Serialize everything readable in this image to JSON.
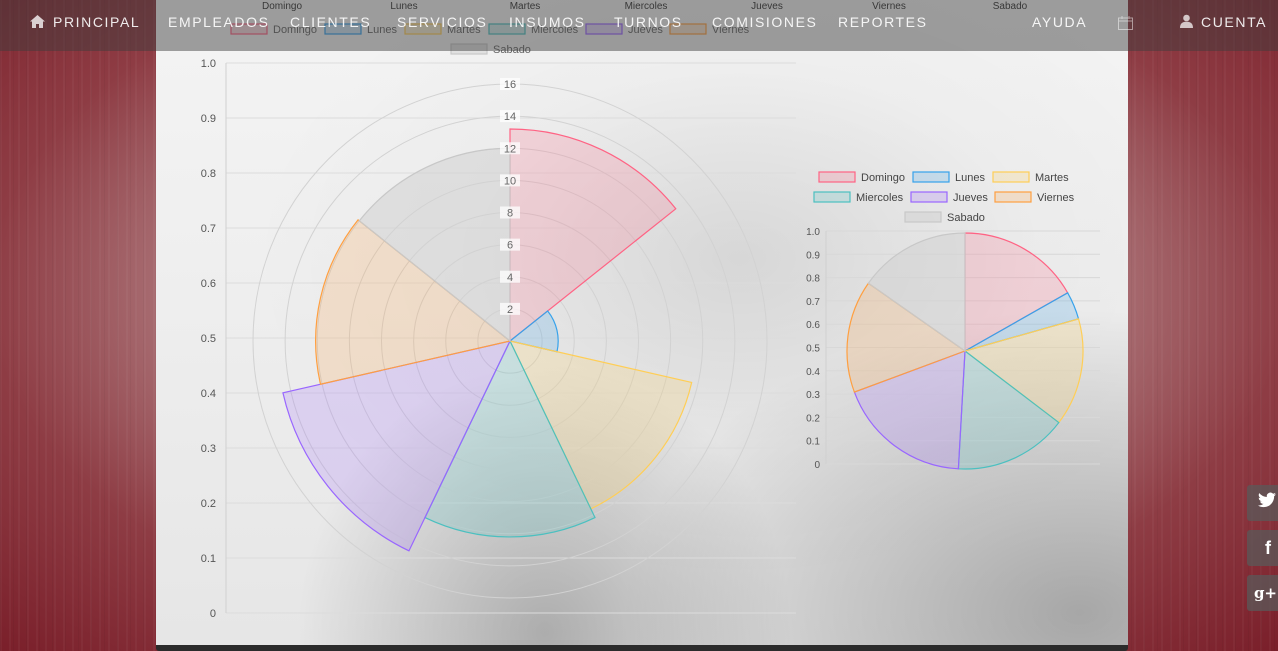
{
  "nav": {
    "items": [
      {
        "label": "PRINCIPAL",
        "icon": "home-icon"
      },
      {
        "label": "EMPLEADOS"
      },
      {
        "label": "CLIENTES"
      },
      {
        "label": "SERVICIOS"
      },
      {
        "label": "INSUMOS"
      },
      {
        "label": "TURNOS"
      },
      {
        "label": "COMISIONES"
      },
      {
        "label": "REPORTES"
      },
      {
        "label": "AYUDA"
      },
      {
        "label": "",
        "icon": "calendar-icon"
      },
      {
        "label": "CUENTA",
        "icon": "user-icon"
      }
    ]
  },
  "social": {
    "twitter": "t",
    "facebook": "f",
    "googleplus": "g+"
  },
  "colors": {
    "Domingo": {
      "fill": "rgba(255,99,132,0.2)",
      "stroke": "rgba(255,99,132,1)"
    },
    "Lunes": {
      "fill": "rgba(54,162,235,0.2)",
      "stroke": "rgba(54,162,235,1)"
    },
    "Martes": {
      "fill": "rgba(255,206,86,0.2)",
      "stroke": "rgba(255,206,86,1)"
    },
    "Miercoles": {
      "fill": "rgba(75,192,192,0.2)",
      "stroke": "rgba(75,192,192,1)"
    },
    "Jueves": {
      "fill": "rgba(153,102,255,0.2)",
      "stroke": "rgba(153,102,255,1)"
    },
    "Viernes": {
      "fill": "rgba(255,159,64,0.2)",
      "stroke": "rgba(255,159,64,1)"
    },
    "Sabado": {
      "fill": "rgba(210,210,210,0.55)",
      "stroke": "rgba(200,200,200,1)"
    }
  },
  "chart_data": [
    {
      "type": "bar",
      "legend_placement": "top",
      "categories": [
        "Domingo",
        "Lunes",
        "Martes",
        "Miercoles",
        "Jueves",
        "Viernes",
        "Sabado"
      ],
      "yaxis_ticks": [
        "1.0",
        "0.9",
        "0.8",
        "0.7",
        "0.6",
        "0.5",
        "0.4",
        "0.3",
        "0.2",
        "0.1",
        "0"
      ],
      "ylim": [
        0,
        1.0
      ]
    },
    {
      "type": "polarArea",
      "legend_placement": "top",
      "labels": [
        "Domingo",
        "Lunes",
        "Martes",
        "Miercoles",
        "Jueves",
        "Viernes",
        "Sabado"
      ],
      "values": [
        13.2,
        3.0,
        11.6,
        12.2,
        14.5,
        12.1,
        12.0
      ],
      "rmax": 16,
      "radial_ticks": [
        "2",
        "4",
        "6",
        "8",
        "10",
        "12",
        "14",
        "16"
      ],
      "grid": true
    },
    {
      "type": "pie",
      "legend_placement": "top",
      "labels": [
        "Domingo",
        "Lunes",
        "Martes",
        "Miercoles",
        "Jueves",
        "Viernes",
        "Sabado"
      ],
      "values": [
        13.2,
        3.0,
        11.6,
        12.2,
        14.5,
        12.1,
        12.0
      ],
      "yaxis_ticks": [
        "1.0",
        "0.9",
        "0.8",
        "0.7",
        "0.6",
        "0.5",
        "0.4",
        "0.3",
        "0.2",
        "0.1",
        "0"
      ]
    }
  ]
}
